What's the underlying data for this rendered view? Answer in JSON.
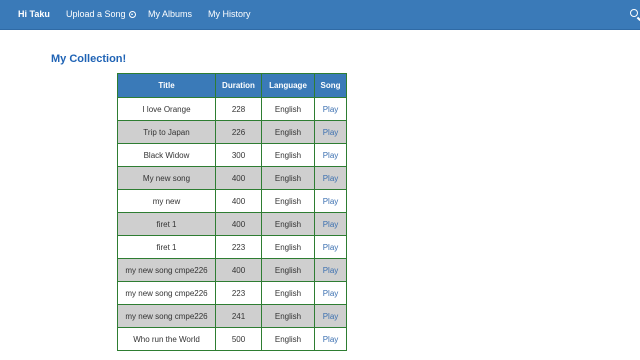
{
  "nav": {
    "brand": "Hi Taku",
    "upload": "Upload a Song",
    "albums": "My Albums",
    "history": "My History"
  },
  "page": {
    "title": "My Collection!"
  },
  "table": {
    "headers": [
      "Title",
      "Duration",
      "Language",
      "Song"
    ],
    "rows": [
      {
        "title": "I love Orange",
        "duration": "228",
        "language": "English",
        "song": "Play"
      },
      {
        "title": "Trip to Japan",
        "duration": "226",
        "language": "English",
        "song": "Play"
      },
      {
        "title": "Black Widow",
        "duration": "300",
        "language": "English",
        "song": "Play"
      },
      {
        "title": "My new song",
        "duration": "400",
        "language": "English",
        "song": "Play"
      },
      {
        "title": "my new",
        "duration": "400",
        "language": "English",
        "song": "Play"
      },
      {
        "title": "firet 1",
        "duration": "400",
        "language": "English",
        "song": "Play"
      },
      {
        "title": "firet 1",
        "duration": "223",
        "language": "English",
        "song": "Play"
      },
      {
        "title": "my new song cmpe226",
        "duration": "400",
        "language": "English",
        "song": "Play"
      },
      {
        "title": "my new song cmpe226",
        "duration": "223",
        "language": "English",
        "song": "Play"
      },
      {
        "title": "my new song cmpe226",
        "duration": "241",
        "language": "English",
        "song": "Play"
      },
      {
        "title": "Who run the World",
        "duration": "500",
        "language": "English",
        "song": "Play"
      }
    ]
  },
  "colors": {
    "navbar": "#3a7ab8",
    "title": "#1f63b5",
    "table_border": "#2e7d32",
    "row_alt": "#cfcfcf",
    "link": "#3a6fb0"
  }
}
